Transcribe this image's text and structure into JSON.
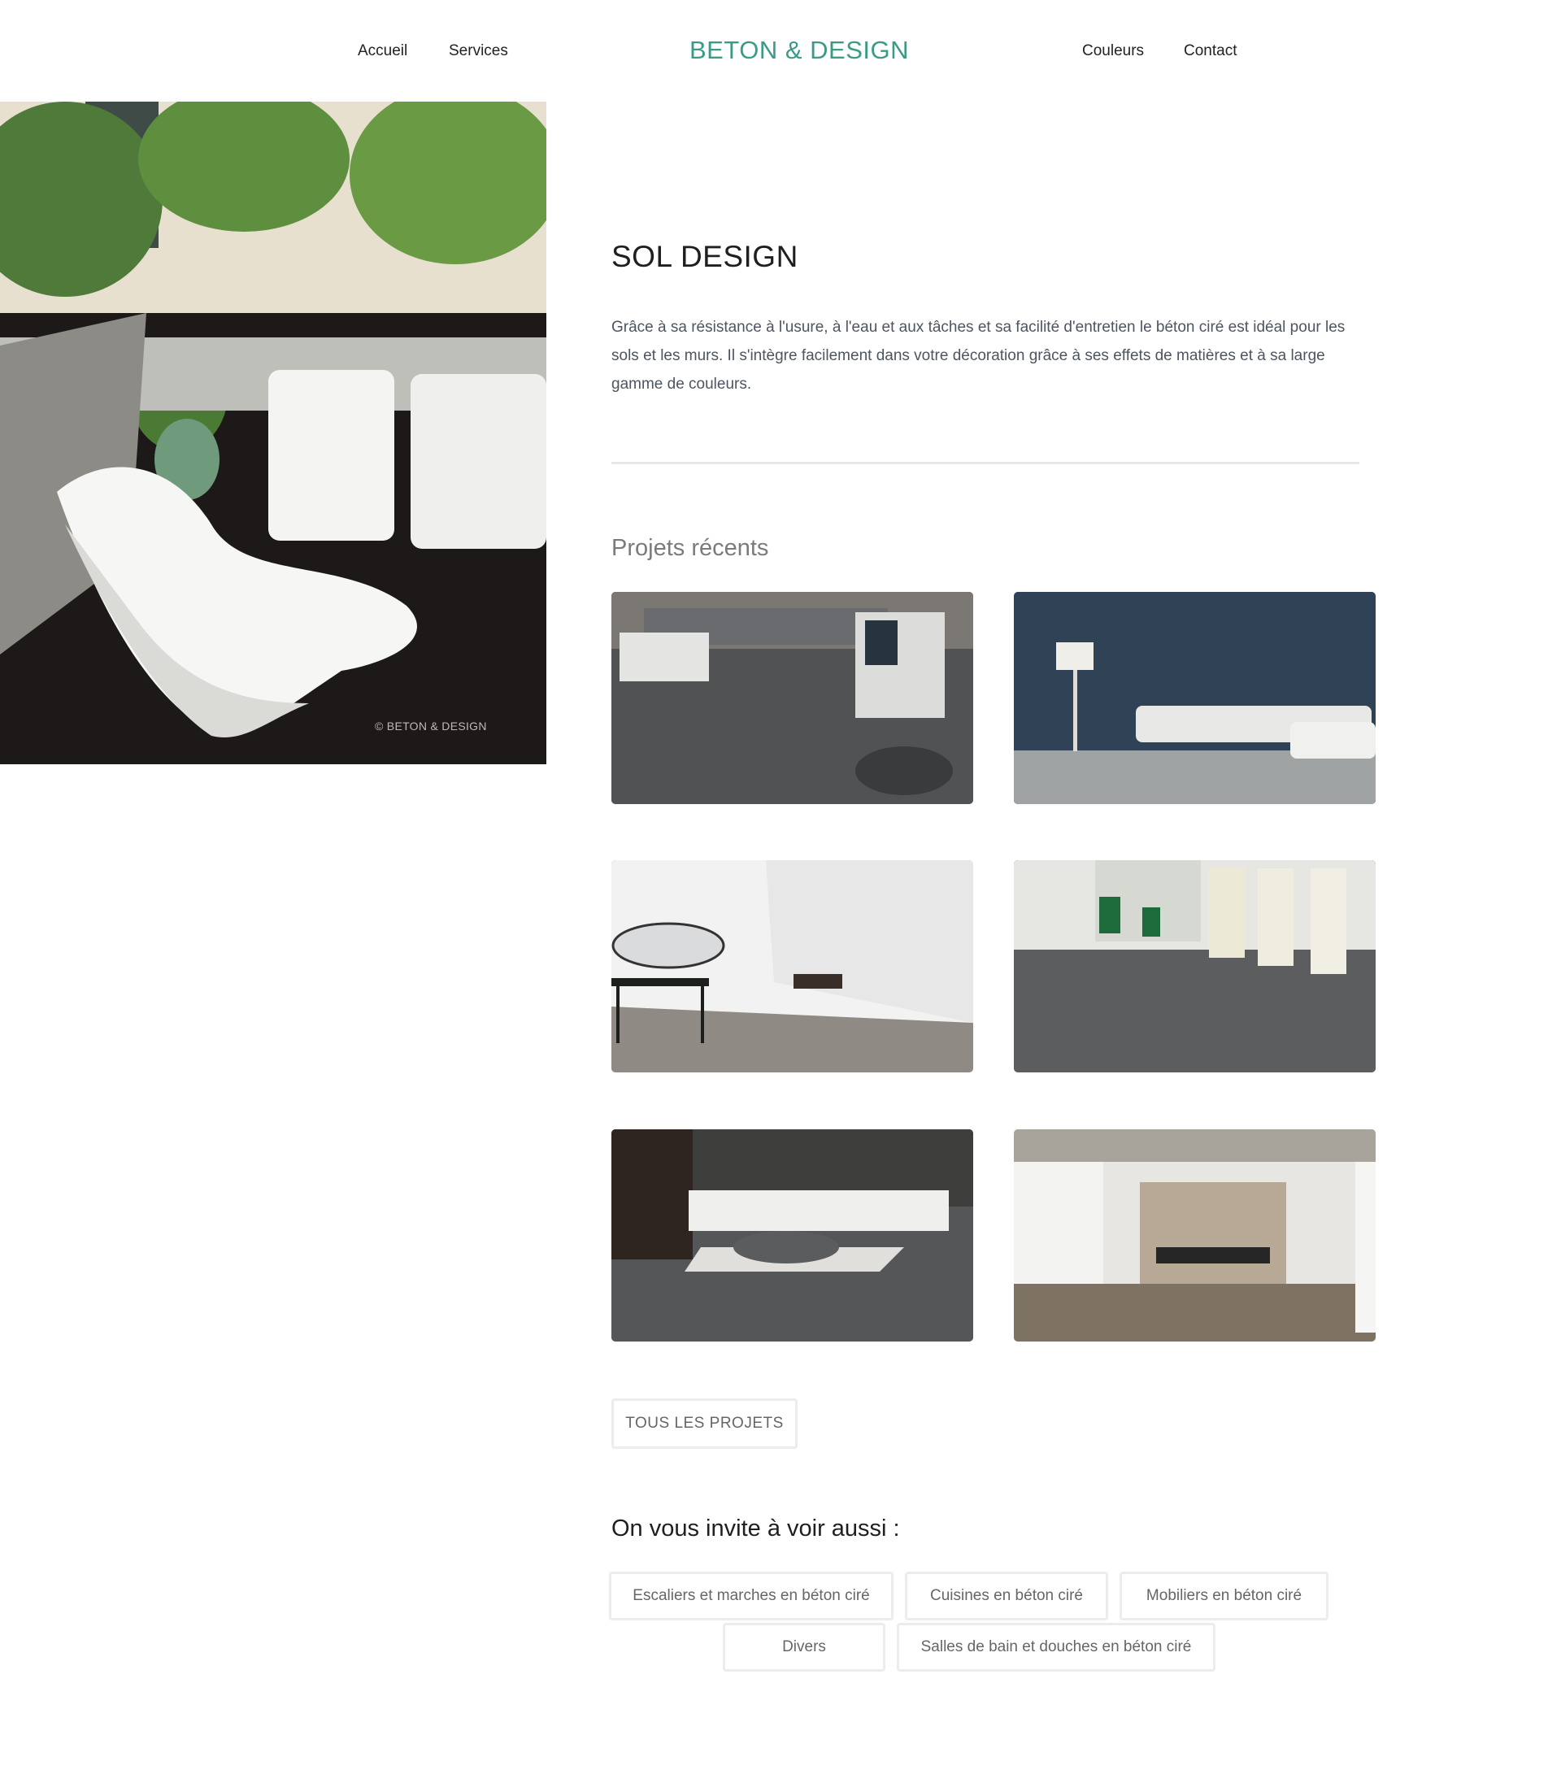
{
  "header": {
    "nav_left": [
      "Accueil",
      "Services"
    ],
    "brand": "BETON & DESIGN",
    "nav_right": [
      "Couleurs",
      "Contact"
    ]
  },
  "hero": {
    "credit": "© BETON & DESIGN"
  },
  "main": {
    "title": "SOL DESIGN",
    "intro": "Grâce à sa résistance à l'usure, à l'eau et aux tâches et sa facilité d'entretien le béton ciré est idéal pour les sols et les murs. Il s'intègre facilement dans votre décoration grâce à ses effets de matières et à sa large gamme de couleurs.",
    "recent_title": "Projets récents",
    "all_projects_label": "TOUS LES PROJETS",
    "see_also_title": "On vous invite à voir aussi :",
    "see_also_tags": [
      "Escaliers et marches en béton ciré",
      "Cuisines en béton ciré",
      "Mobiliers en béton ciré",
      "Divers",
      "Salles de bain et douches en béton ciré"
    ]
  },
  "colors": {
    "brand": "#3a9c86",
    "text": "#4d5560",
    "muted": "#7b7b7b",
    "border": "#ececec"
  }
}
